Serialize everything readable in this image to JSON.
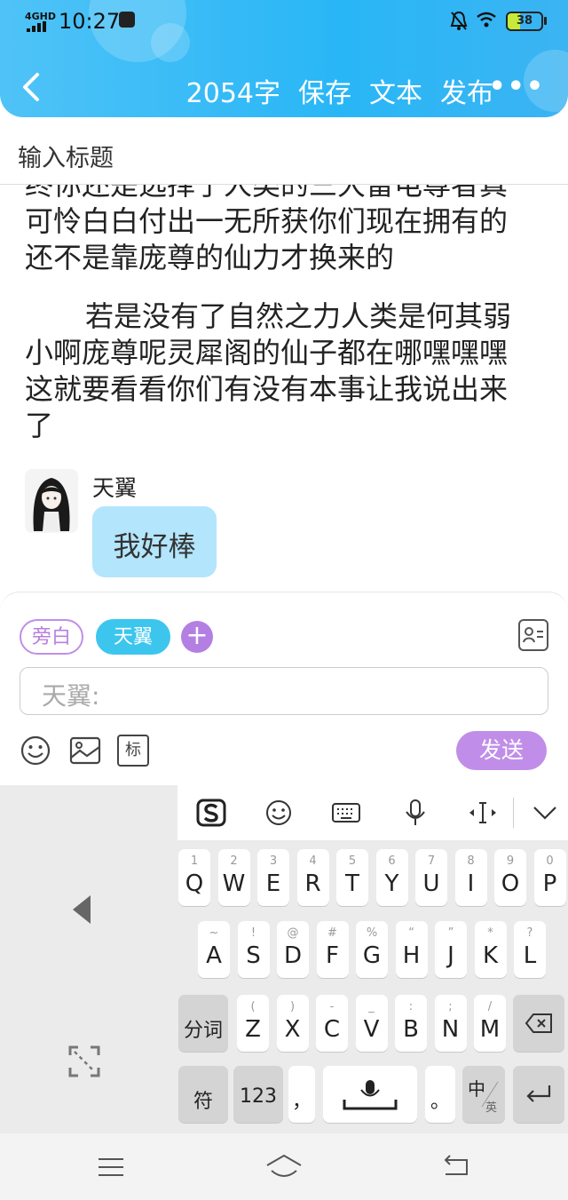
{
  "status_bar": {
    "network": "4GHD",
    "time": "10:27",
    "battery": "38",
    "battery_level_percent": 38
  },
  "header": {
    "word_count": "2054字",
    "save_label": "保存",
    "text_label": "文本",
    "publish_label": "发布",
    "more_label": "•••"
  },
  "title_input": {
    "placeholder": "输入标题"
  },
  "content": {
    "paragraph_1": "终你还是选择了人类的三大雷电尊者真可怜白白付出一无所获你们现在拥有的还不是靠庞尊的仙力才换来的",
    "paragraph_2": "若是没有了自然之力人类是何其弱小啊庞尊呢灵犀阁的仙子都在哪嘿嘿嘿这就要看看你们有没有本事让我说出来了"
  },
  "chat": {
    "name": "天翼",
    "message": "我好棒"
  },
  "compose": {
    "chips": {
      "aside": "旁白",
      "character": "天翼",
      "add": "+"
    },
    "input_placeholder": "天翼:",
    "tools": {
      "label_tag": "标"
    },
    "send_label": "发送"
  },
  "keyboard": {
    "row1": [
      {
        "main": "Q",
        "sub": "1"
      },
      {
        "main": "W",
        "sub": "2"
      },
      {
        "main": "E",
        "sub": "3"
      },
      {
        "main": "R",
        "sub": "4"
      },
      {
        "main": "T",
        "sub": "5"
      },
      {
        "main": "Y",
        "sub": "6"
      },
      {
        "main": "U",
        "sub": "7"
      },
      {
        "main": "I",
        "sub": "8"
      },
      {
        "main": "O",
        "sub": "9"
      },
      {
        "main": "P",
        "sub": "0"
      }
    ],
    "row2": [
      {
        "main": "A",
        "sub": "~"
      },
      {
        "main": "S",
        "sub": "!"
      },
      {
        "main": "D",
        "sub": "@"
      },
      {
        "main": "F",
        "sub": "#"
      },
      {
        "main": "G",
        "sub": "%"
      },
      {
        "main": "H",
        "sub": "“"
      },
      {
        "main": "J",
        "sub": "”"
      },
      {
        "main": "K",
        "sub": "*"
      },
      {
        "main": "L",
        "sub": "?"
      }
    ],
    "row3": [
      {
        "main": "Z",
        "sub": "("
      },
      {
        "main": "X",
        "sub": ")"
      },
      {
        "main": "C",
        "sub": "-"
      },
      {
        "main": "V",
        "sub": "_"
      },
      {
        "main": "B",
        "sub": ":"
      },
      {
        "main": "N",
        "sub": ";"
      },
      {
        "main": "M",
        "sub": "/"
      }
    ],
    "segment_label": "分词",
    "symbol_label": "符",
    "number_label": "123",
    "comma_label": "，",
    "period_label": "。",
    "lang_cn": "中",
    "lang_en": "英"
  }
}
